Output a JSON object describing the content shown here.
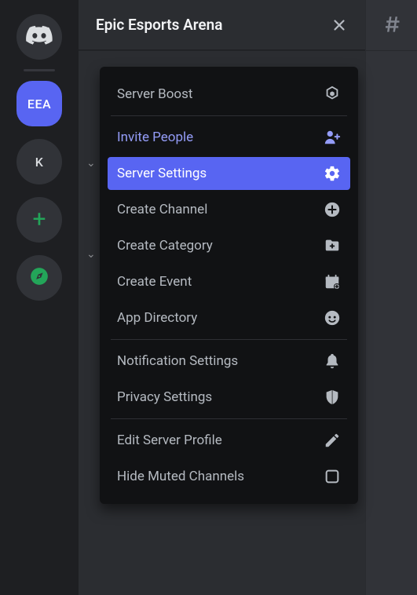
{
  "server_rail": {
    "home": "discord-logo",
    "selected": {
      "label": "EEA"
    },
    "list": [
      {
        "label": "K"
      }
    ],
    "add_label_icon": "+",
    "discover_icon": "compass"
  },
  "header": {
    "title": "Epic Esports Arena",
    "close_icon": "close"
  },
  "main_header": {
    "hash_icon": "hash"
  },
  "menu": {
    "items": [
      {
        "label": "Server Boost",
        "icon": "boost",
        "class": "",
        "sep_after": true
      },
      {
        "label": "Invite People",
        "icon": "invite",
        "class": "invite",
        "sep_after": false
      },
      {
        "label": "Server Settings",
        "icon": "gear",
        "class": "selected",
        "sep_after": false
      },
      {
        "label": "Create Channel",
        "icon": "plus",
        "class": "",
        "sep_after": false
      },
      {
        "label": "Create Category",
        "icon": "folder",
        "class": "",
        "sep_after": false
      },
      {
        "label": "Create Event",
        "icon": "calendar",
        "class": "",
        "sep_after": false
      },
      {
        "label": "App Directory",
        "icon": "bot",
        "class": "",
        "sep_after": true
      },
      {
        "label": "Notification Settings",
        "icon": "bell",
        "class": "",
        "sep_after": false
      },
      {
        "label": "Privacy Settings",
        "icon": "shield",
        "class": "",
        "sep_after": true
      },
      {
        "label": "Edit Server Profile",
        "icon": "pencil",
        "class": "",
        "sep_after": false
      },
      {
        "label": "Hide Muted Channels",
        "icon": "checkbox",
        "class": "",
        "sep_after": false
      }
    ]
  }
}
